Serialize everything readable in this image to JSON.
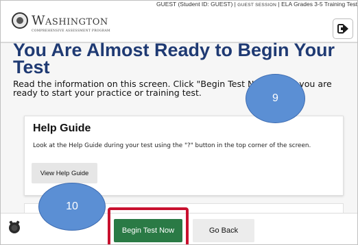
{
  "header": {
    "logo_title": "Washington",
    "logo_subtitle": "Comprehensive Assessment Program",
    "session_user": "GUEST (Student ID: GUEST)",
    "session_label": "GUEST SESSION",
    "test_name": "ELA Grades 3-5 Training Test",
    "separator": "|"
  },
  "main": {
    "title": "You Are Almost Ready to Begin Your Test",
    "intro": "Read the information on this screen. Click \"Begin Test Now\" when you are ready to start your practice or training test."
  },
  "help_card": {
    "title": "Help Guide",
    "text": "Look at the Help Guide during your test using the \"?\" button in the top corner of the screen.",
    "button_label": "View Help Guide"
  },
  "footer": {
    "begin_label": "Begin Test Now",
    "back_label": "Go Back"
  },
  "annotations": {
    "callout_9": "9",
    "callout_10": "10",
    "highlight_color": "#c8102e",
    "callout_color": "#5b8fd4"
  },
  "colors": {
    "title": "#1f3a73",
    "begin_button": "#2a7a45"
  }
}
